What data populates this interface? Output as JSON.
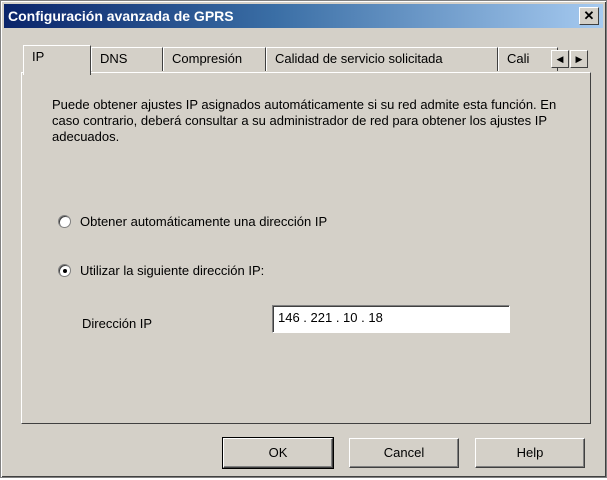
{
  "window": {
    "title": "Configuración avanzada de GPRS",
    "close_glyph": "✕"
  },
  "tabs": [
    {
      "label": "IP",
      "active": true
    },
    {
      "label": "DNS",
      "active": false
    },
    {
      "label": "Compresión",
      "active": false
    },
    {
      "label": "Calidad de servicio solicitada",
      "active": false
    },
    {
      "label": "Cali",
      "active": false
    }
  ],
  "tab_scroll": {
    "left_glyph": "◀",
    "right_glyph": "▶"
  },
  "ip_panel": {
    "description": "Puede obtener ajustes IP asignados automáticamente si su red admite esta función. En caso contrario, deberá consultar a su administrador de red para obtener los ajustes IP adecuados.",
    "option_auto_label": "Obtener automáticamente una dirección IP",
    "option_manual_label": "Utilizar la siguiente dirección IP:",
    "selected_option": "manual",
    "ip_label": "Dirección IP",
    "ip_value": "146 . 221 . 10 . 18"
  },
  "buttons": {
    "ok": "OK",
    "cancel": "Cancel",
    "help": "Help"
  }
}
